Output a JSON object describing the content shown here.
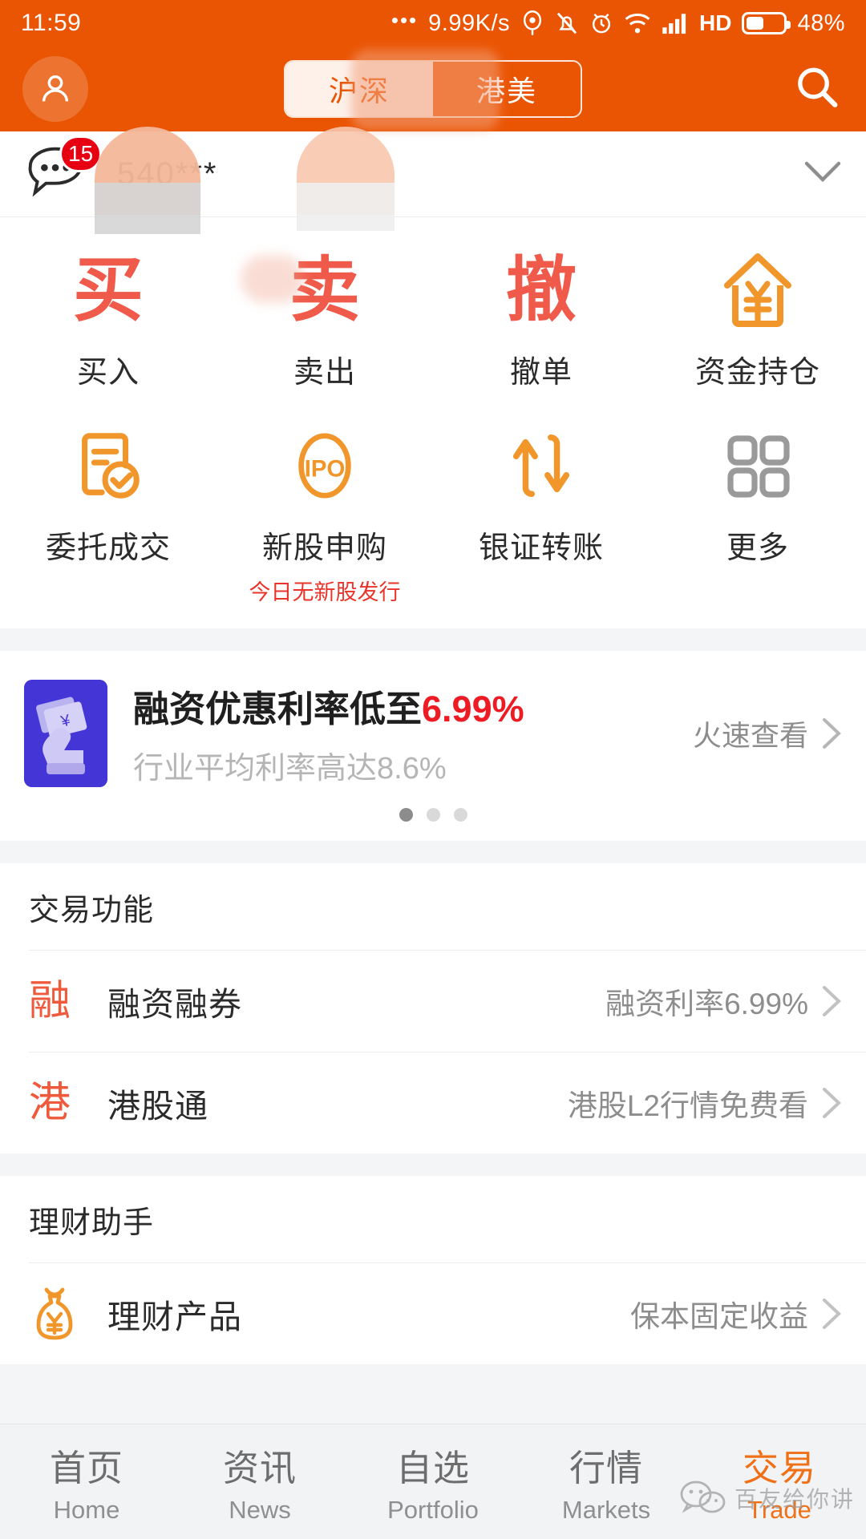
{
  "statusbar": {
    "time": "11:59",
    "dots": "•••",
    "network_speed": "9.99K/s",
    "icons": [
      "location-icon",
      "mute-bell-icon",
      "alarm-icon",
      "wifi-icon",
      "signal-icon"
    ],
    "hd_label": "HD",
    "battery_percent": "48%",
    "battery_level": 48
  },
  "header": {
    "avatar_icon": "user-avatar-icon",
    "search_icon": "search-icon",
    "segments": [
      {
        "label": "沪深",
        "active": true
      },
      {
        "label": "港美",
        "active": false
      }
    ]
  },
  "account": {
    "message_icon": "chat-bubble-icon",
    "unread_badge": "15",
    "account_number": "540***",
    "chevron_icon": "chevron-down-icon"
  },
  "actions": {
    "row1": [
      {
        "glyph": "买",
        "label": "买入",
        "icon": "buy-char-icon",
        "color": "#ef5a4a"
      },
      {
        "glyph": "卖",
        "label": "卖出",
        "icon": "sell-char-icon",
        "color": "#ef5a4a"
      },
      {
        "glyph": "撤",
        "label": "撤单",
        "icon": "cancel-char-icon",
        "color": "#ef5a4a"
      },
      {
        "glyph": "",
        "label": "资金持仓",
        "icon": "house-yen-icon",
        "color": "#f0962a"
      }
    ],
    "row2": [
      {
        "label": "委托成交",
        "icon": "document-check-icon",
        "sub": ""
      },
      {
        "label": "新股申购",
        "icon": "ipo-icon",
        "sub": "今日无新股发行"
      },
      {
        "label": "银证转账",
        "icon": "transfer-arrows-icon",
        "sub": ""
      },
      {
        "label": "更多",
        "icon": "grid-more-icon",
        "sub": ""
      }
    ]
  },
  "promo": {
    "icon": "hand-money-icon",
    "title_prefix": "融资优惠利率低至",
    "title_highlight": "6.99%",
    "subtitle": "行业平均利率高达8.6%",
    "cta": "火速查看",
    "cta_chevron": "chevron-right-icon",
    "dots_total": 3,
    "dots_active_index": 0
  },
  "sections": [
    {
      "title": "交易功能",
      "rows": [
        {
          "glyph": "融",
          "label": "融资融券",
          "value": "融资利率6.99%",
          "icon": "margin-trading-icon"
        },
        {
          "glyph": "港",
          "label": "港股通",
          "value": "港股L2行情免费看",
          "icon": "hk-connect-icon"
        }
      ]
    },
    {
      "title": "理财助手",
      "rows": [
        {
          "glyph": "",
          "label": "理财产品",
          "value": "保本固定收益",
          "icon": "money-bag-icon"
        }
      ]
    }
  ],
  "tabbar": [
    {
      "cn": "首页",
      "en": "Home",
      "active": false
    },
    {
      "cn": "资讯",
      "en": "News",
      "active": false
    },
    {
      "cn": "自选",
      "en": "Portfolio",
      "active": false
    },
    {
      "cn": "行情",
      "en": "Markets",
      "active": false
    },
    {
      "cn": "交易",
      "en": "Trade",
      "active": true
    }
  ],
  "watermark": {
    "icon": "wechat-icon",
    "text": "百友给你讲"
  },
  "colors": {
    "brand_orange": "#ea5504",
    "accent_orange": "#f0962a",
    "red": "#ed1c24",
    "tab_active": "#f07018",
    "page_bg": "#f4f5f7"
  }
}
